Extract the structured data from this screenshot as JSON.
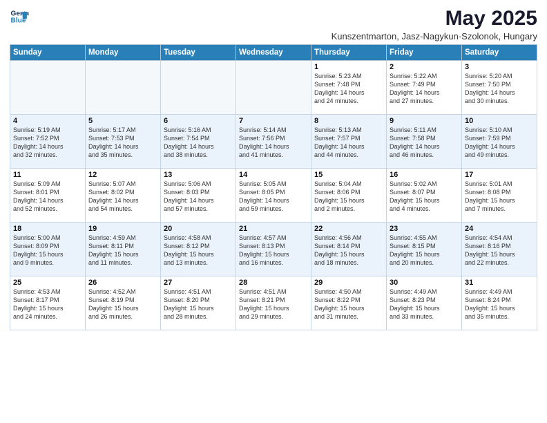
{
  "header": {
    "logo_line1": "General",
    "logo_line2": "Blue",
    "title": "May 2025",
    "subtitle": "Kunszentmarton, Jasz-Nagykun-Szolonok, Hungary"
  },
  "weekdays": [
    "Sunday",
    "Monday",
    "Tuesday",
    "Wednesday",
    "Thursday",
    "Friday",
    "Saturday"
  ],
  "weeks": [
    [
      {
        "day": "",
        "info": ""
      },
      {
        "day": "",
        "info": ""
      },
      {
        "day": "",
        "info": ""
      },
      {
        "day": "",
        "info": ""
      },
      {
        "day": "1",
        "info": "Sunrise: 5:23 AM\nSunset: 7:48 PM\nDaylight: 14 hours\nand 24 minutes."
      },
      {
        "day": "2",
        "info": "Sunrise: 5:22 AM\nSunset: 7:49 PM\nDaylight: 14 hours\nand 27 minutes."
      },
      {
        "day": "3",
        "info": "Sunrise: 5:20 AM\nSunset: 7:50 PM\nDaylight: 14 hours\nand 30 minutes."
      }
    ],
    [
      {
        "day": "4",
        "info": "Sunrise: 5:19 AM\nSunset: 7:52 PM\nDaylight: 14 hours\nand 32 minutes."
      },
      {
        "day": "5",
        "info": "Sunrise: 5:17 AM\nSunset: 7:53 PM\nDaylight: 14 hours\nand 35 minutes."
      },
      {
        "day": "6",
        "info": "Sunrise: 5:16 AM\nSunset: 7:54 PM\nDaylight: 14 hours\nand 38 minutes."
      },
      {
        "day": "7",
        "info": "Sunrise: 5:14 AM\nSunset: 7:56 PM\nDaylight: 14 hours\nand 41 minutes."
      },
      {
        "day": "8",
        "info": "Sunrise: 5:13 AM\nSunset: 7:57 PM\nDaylight: 14 hours\nand 44 minutes."
      },
      {
        "day": "9",
        "info": "Sunrise: 5:11 AM\nSunset: 7:58 PM\nDaylight: 14 hours\nand 46 minutes."
      },
      {
        "day": "10",
        "info": "Sunrise: 5:10 AM\nSunset: 7:59 PM\nDaylight: 14 hours\nand 49 minutes."
      }
    ],
    [
      {
        "day": "11",
        "info": "Sunrise: 5:09 AM\nSunset: 8:01 PM\nDaylight: 14 hours\nand 52 minutes."
      },
      {
        "day": "12",
        "info": "Sunrise: 5:07 AM\nSunset: 8:02 PM\nDaylight: 14 hours\nand 54 minutes."
      },
      {
        "day": "13",
        "info": "Sunrise: 5:06 AM\nSunset: 8:03 PM\nDaylight: 14 hours\nand 57 minutes."
      },
      {
        "day": "14",
        "info": "Sunrise: 5:05 AM\nSunset: 8:05 PM\nDaylight: 14 hours\nand 59 minutes."
      },
      {
        "day": "15",
        "info": "Sunrise: 5:04 AM\nSunset: 8:06 PM\nDaylight: 15 hours\nand 2 minutes."
      },
      {
        "day": "16",
        "info": "Sunrise: 5:02 AM\nSunset: 8:07 PM\nDaylight: 15 hours\nand 4 minutes."
      },
      {
        "day": "17",
        "info": "Sunrise: 5:01 AM\nSunset: 8:08 PM\nDaylight: 15 hours\nand 7 minutes."
      }
    ],
    [
      {
        "day": "18",
        "info": "Sunrise: 5:00 AM\nSunset: 8:09 PM\nDaylight: 15 hours\nand 9 minutes."
      },
      {
        "day": "19",
        "info": "Sunrise: 4:59 AM\nSunset: 8:11 PM\nDaylight: 15 hours\nand 11 minutes."
      },
      {
        "day": "20",
        "info": "Sunrise: 4:58 AM\nSunset: 8:12 PM\nDaylight: 15 hours\nand 13 minutes."
      },
      {
        "day": "21",
        "info": "Sunrise: 4:57 AM\nSunset: 8:13 PM\nDaylight: 15 hours\nand 16 minutes."
      },
      {
        "day": "22",
        "info": "Sunrise: 4:56 AM\nSunset: 8:14 PM\nDaylight: 15 hours\nand 18 minutes."
      },
      {
        "day": "23",
        "info": "Sunrise: 4:55 AM\nSunset: 8:15 PM\nDaylight: 15 hours\nand 20 minutes."
      },
      {
        "day": "24",
        "info": "Sunrise: 4:54 AM\nSunset: 8:16 PM\nDaylight: 15 hours\nand 22 minutes."
      }
    ],
    [
      {
        "day": "25",
        "info": "Sunrise: 4:53 AM\nSunset: 8:17 PM\nDaylight: 15 hours\nand 24 minutes."
      },
      {
        "day": "26",
        "info": "Sunrise: 4:52 AM\nSunset: 8:19 PM\nDaylight: 15 hours\nand 26 minutes."
      },
      {
        "day": "27",
        "info": "Sunrise: 4:51 AM\nSunset: 8:20 PM\nDaylight: 15 hours\nand 28 minutes."
      },
      {
        "day": "28",
        "info": "Sunrise: 4:51 AM\nSunset: 8:21 PM\nDaylight: 15 hours\nand 29 minutes."
      },
      {
        "day": "29",
        "info": "Sunrise: 4:50 AM\nSunset: 8:22 PM\nDaylight: 15 hours\nand 31 minutes."
      },
      {
        "day": "30",
        "info": "Sunrise: 4:49 AM\nSunset: 8:23 PM\nDaylight: 15 hours\nand 33 minutes."
      },
      {
        "day": "31",
        "info": "Sunrise: 4:49 AM\nSunset: 8:24 PM\nDaylight: 15 hours\nand 35 minutes."
      }
    ]
  ]
}
